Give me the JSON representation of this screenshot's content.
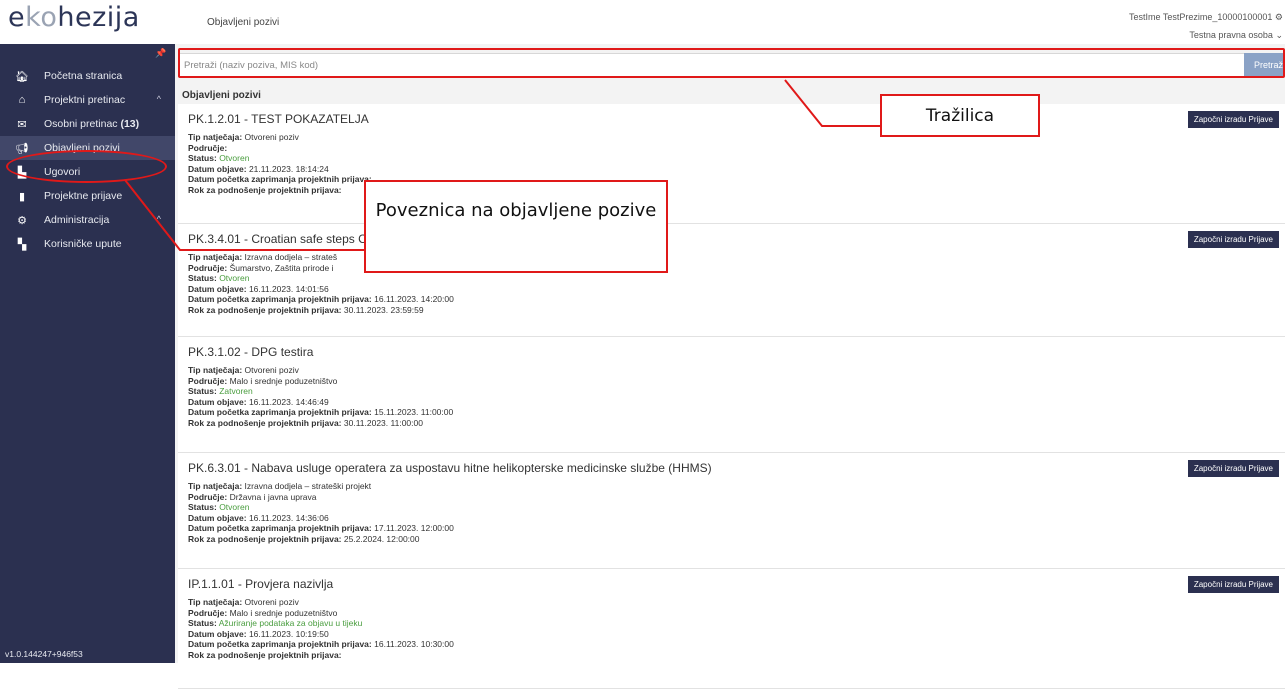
{
  "app": {
    "logo": "ekohezija",
    "page_label": "Objavljeni pozivi",
    "user_name": "TestIme TestPrezime_10000100001",
    "user_role": "Testna pravna osoba"
  },
  "sidebar": {
    "items": [
      {
        "label": "Početna stranica",
        "icon": "home-icon"
      },
      {
        "label": "Projektni pretinac",
        "icon": "inbox-icon",
        "expandable": true
      },
      {
        "label": "Osobni pretinac",
        "count": "(13)",
        "icon": "envelope-icon"
      },
      {
        "label": "Objavljeni pozivi",
        "icon": "megaphone-icon",
        "active": true
      },
      {
        "label": "Ugovori",
        "icon": "contract-icon"
      },
      {
        "label": "Projektne prijave",
        "icon": "document-icon"
      },
      {
        "label": "Administracija",
        "icon": "gears-icon",
        "expandable": true
      },
      {
        "label": "Korisničke upute",
        "icon": "pdf-icon"
      }
    ],
    "version": "v1.0.144247+946f53"
  },
  "search": {
    "placeholder": "Pretraži (naziv poziva, MIS kod)",
    "button_label": "Pretraži"
  },
  "section_title": "Objavljeni pozivi",
  "labels": {
    "type": "Tip natječaja:",
    "area": "Područje:",
    "status": "Status:",
    "published": "Datum objave:",
    "start": "Datum početka zaprimanja projektnih prijava:",
    "deadline": "Rok za podnošenje projektnih prijava:",
    "apply_button": "Započni izradu Prijave"
  },
  "calls": [
    {
      "title": "PK.1.2.01 - TEST POKAZATELJA",
      "type": "Otvoreni poziv",
      "area": "",
      "status": "Otvoren",
      "published": "21.11.2023. 18:14:24",
      "start": "",
      "deadline": "",
      "has_button": true
    },
    {
      "title": "PK.3.4.01 - Croatian safe steps C",
      "type": "Izravna dodjela – strateš",
      "area": "Šumarstvo, Zaštita prirode i",
      "status": "Otvoren",
      "published": "16.11.2023. 14:01:56",
      "start": "16.11.2023. 14:20:00",
      "deadline": "30.11.2023. 23:59:59",
      "has_button": true
    },
    {
      "title": "PK.3.1.02 - DPG testira",
      "type": "Otvoreni poziv",
      "area": "Malo i srednje poduzetništvo",
      "status": "Zatvoren",
      "published": "16.11.2023. 14:46:49",
      "start": "15.11.2023. 11:00:00",
      "deadline": "30.11.2023. 11:00:00",
      "has_button": false
    },
    {
      "title": "PK.6.3.01 - Nabava usluge operatera za uspostavu hitne helikopterske medicinske službe (HHMS)",
      "type": "Izravna dodjela – strateški projekt",
      "area": "Državna i javna uprava",
      "status": "Otvoren",
      "published": "16.11.2023. 14:36:06",
      "start": "17.11.2023. 12:00:00",
      "deadline": "25.2.2024. 12:00:00",
      "has_button": true
    },
    {
      "title": "IP.1.1.01 - Provjera nazivlja",
      "type": "Otvoreni poziv",
      "area": "Malo i srednje poduzetništvo",
      "status": "Ažuriranje podataka za objavu u tijeku",
      "published": "16.11.2023. 10:19:50",
      "start": "16.11.2023. 10:30:00",
      "deadline": "",
      "has_button": true
    }
  ],
  "annotations": {
    "search_callout": "Tražilica",
    "nav_callout": "Poveznica na objavljene pozive",
    "color": "#e01919"
  }
}
